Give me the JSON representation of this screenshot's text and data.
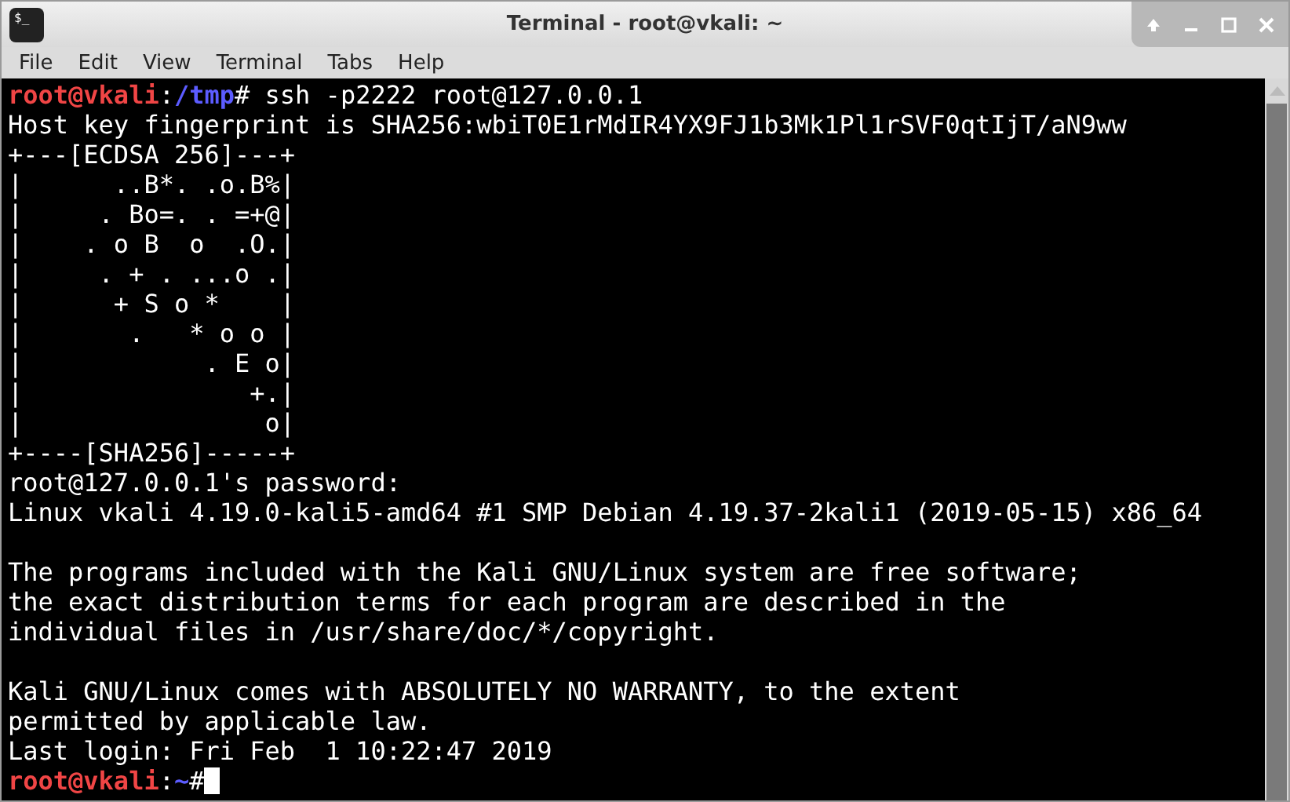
{
  "window": {
    "title": "Terminal - root@vkali: ~",
    "icon_text": "$_"
  },
  "menu": [
    "File",
    "Edit",
    "View",
    "Terminal",
    "Tabs",
    "Help"
  ],
  "terminal": {
    "lines": [
      {
        "kind": "prompt",
        "user_host": "root@vkali",
        "separator": ":",
        "path": "/tmp",
        "symbol": "#",
        "command": " ssh -p2222 root@127.0.0.1",
        "cursor": false
      },
      {
        "kind": "output",
        "text": "Host key fingerprint is SHA256:wbiT0E1rMdIR4YX9FJ1b3Mk1Pl1rSVF0qtIjT/aN9ww"
      },
      {
        "kind": "output",
        "text": "+---[ECDSA 256]---+"
      },
      {
        "kind": "output",
        "text": "|      ..B*. .o.B%|"
      },
      {
        "kind": "output",
        "text": "|     . Bo=. . =+@|"
      },
      {
        "kind": "output",
        "text": "|    . o B  o  .O.|"
      },
      {
        "kind": "output",
        "text": "|     . + . ...o .|"
      },
      {
        "kind": "output",
        "text": "|      + S o *    |"
      },
      {
        "kind": "output",
        "text": "|       .   * o o |"
      },
      {
        "kind": "output",
        "text": "|            . E o|"
      },
      {
        "kind": "output",
        "text": "|               +.|"
      },
      {
        "kind": "output",
        "text": "|                o|"
      },
      {
        "kind": "output",
        "text": "+----[SHA256]-----+"
      },
      {
        "kind": "output",
        "text": "root@127.0.0.1's password:"
      },
      {
        "kind": "output",
        "text": "Linux vkali 4.19.0-kali5-amd64 #1 SMP Debian 4.19.37-2kali1 (2019-05-15) x86_64"
      },
      {
        "kind": "blank"
      },
      {
        "kind": "output",
        "text": "The programs included with the Kali GNU/Linux system are free software;"
      },
      {
        "kind": "output",
        "text": "the exact distribution terms for each program are described in the"
      },
      {
        "kind": "output",
        "text": "individual files in /usr/share/doc/*/copyright."
      },
      {
        "kind": "blank"
      },
      {
        "kind": "output",
        "text": "Kali GNU/Linux comes with ABSOLUTELY NO WARRANTY, to the extent"
      },
      {
        "kind": "output",
        "text": "permitted by applicable law."
      },
      {
        "kind": "output",
        "text": "Last login: Fri Feb  1 10:22:47 2019"
      },
      {
        "kind": "prompt",
        "user_host": "root@vkali",
        "separator": ":",
        "path": "~",
        "symbol": "#",
        "cursor": true
      }
    ]
  }
}
